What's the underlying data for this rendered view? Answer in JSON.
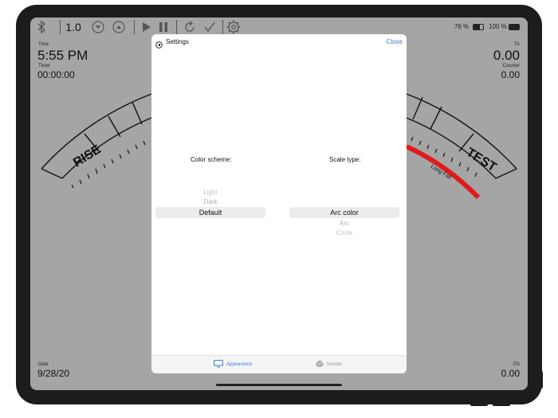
{
  "toolbar": {
    "version_value": "1.0",
    "icons": [
      "bluetooth-icon",
      "chevron-down-icon",
      "chevron-up-icon",
      "play-icon",
      "pause-icon",
      "refresh-icon",
      "checkmark-icon",
      "gear-icon"
    ]
  },
  "status_bar": {
    "battery_percent_a": "76 %",
    "battery_percent_b": "100 %"
  },
  "readouts": {
    "time_label": "Time",
    "time_value": "5:55 PM",
    "timer_label": "Timer",
    "timer_value": "00:00:00",
    "ta_label": "TA",
    "ta_value": "0.00",
    "counter_label": "Counter",
    "counter_value": "0.00",
    "date_label": "Date",
    "date_value": "9/28/20",
    "ita_label": "iTA",
    "ita_value": "0.00"
  },
  "gauge": {
    "left_label": "RISE",
    "right_label": "TEST",
    "arc_label": "Long Fall",
    "arc_color": "#e01b1b"
  },
  "settings": {
    "title": "Settings",
    "close_label": "Close",
    "color_scheme_label": "Color scheme:",
    "color_scheme_options": [
      "Light",
      "Dark",
      "Default"
    ],
    "scale_type_label": "Scale type:",
    "scale_type_options": [
      "Arc color",
      "Arc",
      "Circle"
    ],
    "tabs": [
      {
        "label": "Appearance",
        "icon": "monitor-icon",
        "selected": true
      },
      {
        "label": "Needle",
        "icon": "cube-icon",
        "selected": false
      }
    ],
    "accent_color": "#3a7bd5"
  }
}
